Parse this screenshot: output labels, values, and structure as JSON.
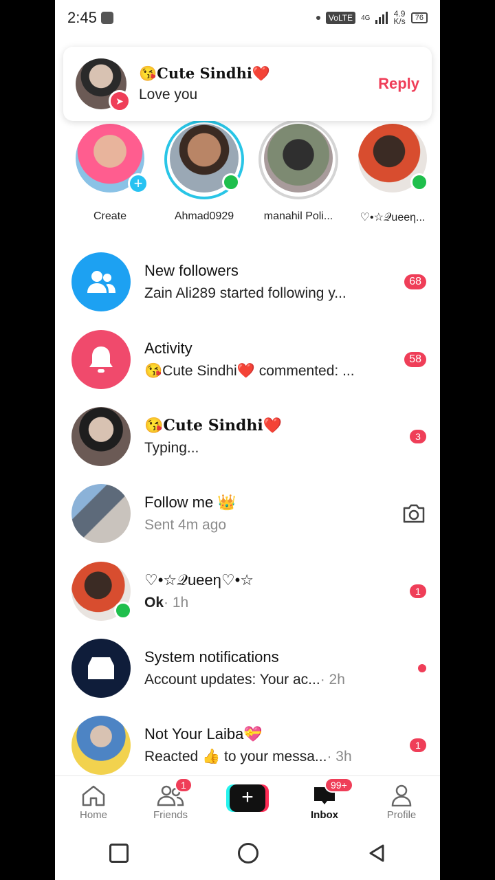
{
  "status_bar": {
    "time": "2:45",
    "network": "VoLTE",
    "gen": "4G",
    "speed": "4.9",
    "speed_unit": "K/s",
    "battery": "76"
  },
  "notification": {
    "name": "😘Cute Sindhi❤️",
    "message": "Love you",
    "reply_label": "Reply"
  },
  "stories": [
    {
      "label": "Create"
    },
    {
      "label": "Ahmad0929"
    },
    {
      "label": "manahil Poli..."
    },
    {
      "label": "♡•☆𝒬ueeη..."
    }
  ],
  "inbox": [
    {
      "title": "New followers",
      "subtitle": "Zain Ali289 started following y...",
      "meta": "",
      "badge": "68"
    },
    {
      "title": "Activity",
      "subtitle": "😘Cute Sindhi❤️ commented: ...",
      "meta": "",
      "badge": "58"
    },
    {
      "title": "😘Cute Sindhi❤️",
      "subtitle": "Typing...",
      "meta": "",
      "badge": "3"
    },
    {
      "title": "Follow me 👑",
      "subtitle": "Sent 4m ago",
      "meta": "",
      "badge": ""
    },
    {
      "title": "♡•☆𝒬ueeη♡•☆",
      "subtitle": "Ok",
      "meta": " · 1h",
      "badge": "1"
    },
    {
      "title": "System notifications",
      "subtitle": "Account updates: Your ac...",
      "meta": " · 2h",
      "badge": ""
    },
    {
      "title": "Not Your Laiba💝",
      "subtitle": "Reacted 👍 to your messa...",
      "meta": " · 3h",
      "badge": "1"
    }
  ],
  "tabbar": {
    "home": "Home",
    "friends": "Friends",
    "friends_count": "1",
    "create": "+",
    "inbox": "Inbox",
    "inbox_count": "99+",
    "profile": "Profile"
  },
  "colors": {
    "accent": "#ef3e58",
    "online": "#1fbf4c",
    "followers_icon": "#1da1f2",
    "activity_icon": "#f04a6c",
    "system_icon": "#0f1d3a"
  }
}
